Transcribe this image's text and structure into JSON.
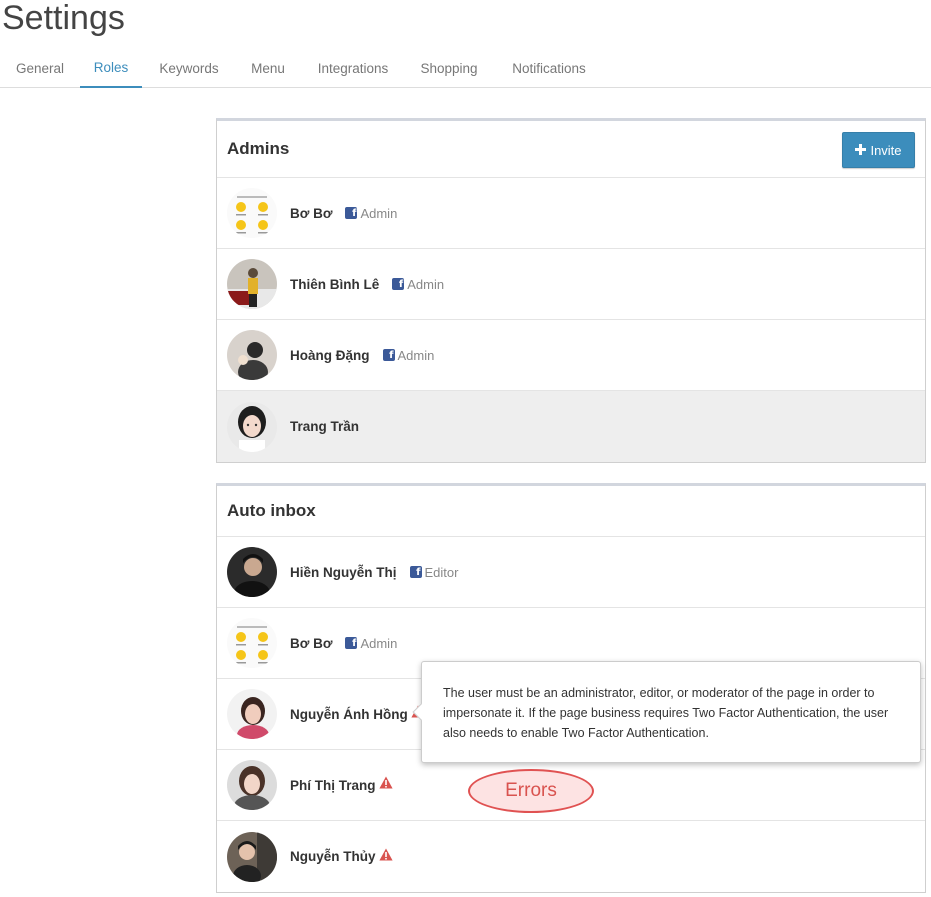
{
  "page": {
    "title": "Settings"
  },
  "tabs": [
    {
      "label": "General"
    },
    {
      "label": "Roles"
    },
    {
      "label": "Keywords"
    },
    {
      "label": "Menu"
    },
    {
      "label": "Integrations"
    },
    {
      "label": "Shopping"
    },
    {
      "label": "Notifications"
    }
  ],
  "active_tab": "Roles",
  "admins": {
    "title": "Admins",
    "invite_label": "Invite",
    "members": [
      {
        "name": "Bơ Bơ",
        "role": "Admin"
      },
      {
        "name": "Thiên Bình Lê",
        "role": "Admin"
      },
      {
        "name": "Hoàng Đặng",
        "role": "Admin"
      },
      {
        "name": "Trang Trần"
      }
    ]
  },
  "auto_inbox": {
    "title": "Auto inbox",
    "members": [
      {
        "name": "Hiền Nguyễn Thị",
        "role": "Editor"
      },
      {
        "name": "Bơ Bơ",
        "role": "Admin"
      },
      {
        "name": "Nguyễn Ánh Hồng",
        "warning": true
      },
      {
        "name": "Phí Thị Trang",
        "warning": true
      },
      {
        "name": "Nguyễn Thủy",
        "warning": true
      }
    ]
  },
  "tooltip": {
    "text": "The user must be an administrator, editor, or moderator of the page in order to impersonate it. If the page business requires Two Factor Authentication, the user also needs to enable Two Factor Authentication."
  },
  "annotation": {
    "label": "Errors"
  },
  "colors": {
    "accent": "#3c8dbc",
    "facebook": "#3b5998",
    "warning": "#d9534f",
    "highlight_row": "#eeeeee"
  }
}
